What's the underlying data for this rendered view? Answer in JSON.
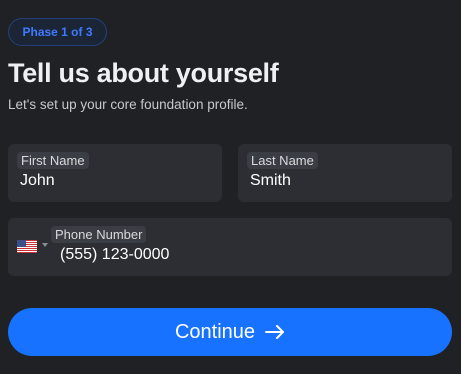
{
  "header": {
    "phase_badge": "Phase 1 of 3",
    "title": "Tell us about yourself",
    "subtitle": "Let's set up your core foundation profile."
  },
  "form": {
    "first_name": {
      "label": "First Name",
      "value": "John"
    },
    "last_name": {
      "label": "Last Name",
      "value": "Smith"
    },
    "phone": {
      "label": "Phone Number",
      "value": "(555) 123-0000",
      "country_icon": "us-flag-icon"
    }
  },
  "actions": {
    "continue_label": "Continue",
    "continue_icon": "arrow-right-icon"
  },
  "colors": {
    "background": "#202124",
    "field": "#2c2e33",
    "accent": "#1773ff",
    "badge_text": "#3f7bff"
  }
}
